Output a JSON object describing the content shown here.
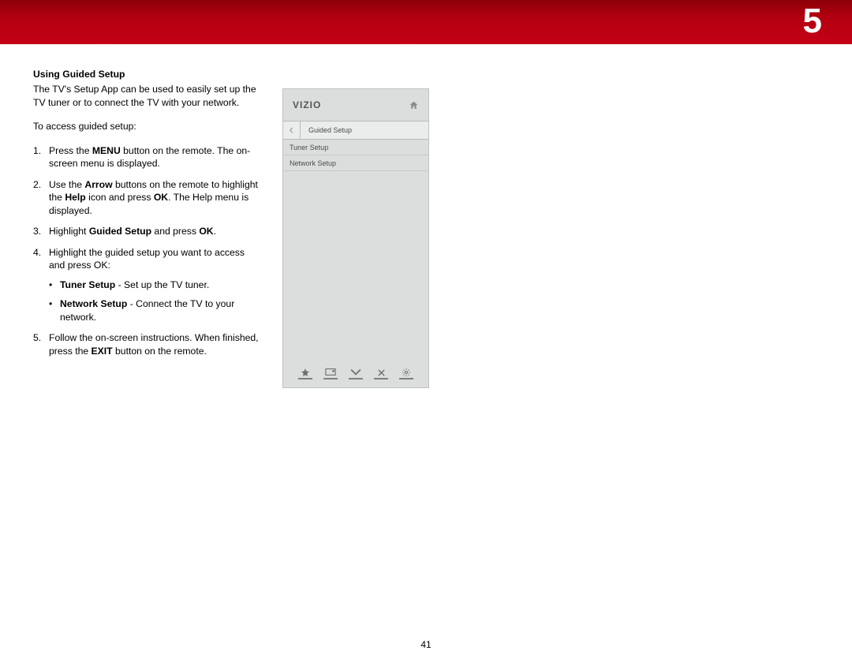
{
  "chapter": "5",
  "section_title": "Using Guided Setup",
  "intro": "The TV's Setup App can be used to easily set up the TV tuner or to connect the TV with your network.",
  "lead": "To access guided setup:",
  "steps": {
    "s1a": "Press the ",
    "s1b": "MENU",
    "s1c": " button on the remote. The on-screen menu is displayed.",
    "s2a": "Use the ",
    "s2b": "Arrow",
    "s2c": " buttons on the remote to highlight the ",
    "s2d": "Help",
    "s2e": " icon and press ",
    "s2f": "OK",
    "s2g": ". The Help menu is displayed.",
    "s3a": "Highlight ",
    "s3b": "Guided Setup",
    "s3c": " and press ",
    "s3d": "OK",
    "s3e": ".",
    "s4": "Highlight the guided setup you want to access and press OK:",
    "b1a": "Tuner Setup",
    "b1b": " - Set up the TV tuner.",
    "b2a": "Network Setup",
    "b2b": " - Connect the TV to your network.",
    "s5a": "Follow the on-screen instructions. When finished, press the ",
    "s5b": "EXIT",
    "s5c": " button on the remote."
  },
  "panel": {
    "brand": "VIZIO",
    "crumb": "Guided Setup",
    "items": [
      "Tuner Setup",
      "Network Setup"
    ]
  },
  "page_number": "41"
}
